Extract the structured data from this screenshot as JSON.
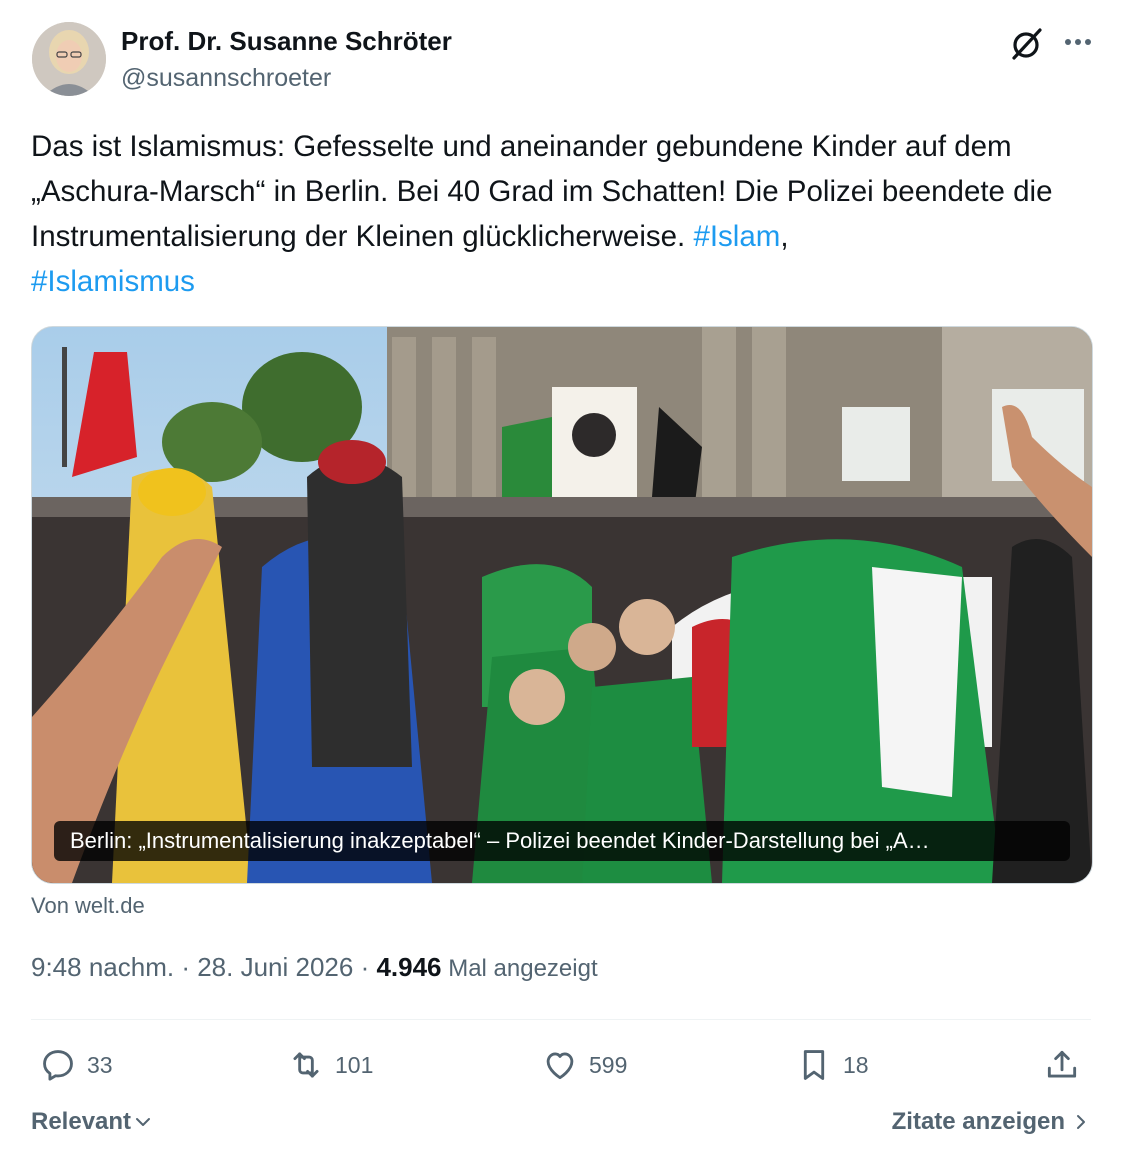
{
  "author": {
    "name": "Prof. Dr. Susanne Schröter",
    "handle": "@susannschroeter",
    "avatar_icon": "avatar-photo"
  },
  "header_icons": [
    "grok-icon",
    "more-options-icon"
  ],
  "tweet": {
    "text_main": "Das ist Islamismus: Gefesselte und aneinander gebundene Kinder auf dem „Aschura-Marsch“ in Berlin. Bei 40 Grad im Schatten! Die Polizei beendete die Instrumentalisierung der Kleinen glücklicherweise. ",
    "hashtag_1": "#Islam",
    "separator": ",",
    "hashtag_2": "#Islamismus"
  },
  "link_card": {
    "caption": "Berlin: „Instrumentalisierung inakzeptabel“ – Polizei beendet Kinder-Darstellung bei „A…",
    "source": "Von welt.de"
  },
  "meta": {
    "time": "9:48 nachm.",
    "sep1": " · ",
    "date": "28. Juni 2026",
    "sep2": " · ",
    "views_count": "4.946",
    "views_label": " Mal angezeigt"
  },
  "actions": {
    "replies": "33",
    "retweets": "101",
    "likes": "599",
    "bookmarks": "18"
  },
  "footer": {
    "sort_label": "Relevant",
    "quotes_label": "Zitate anzeigen"
  },
  "colors": {
    "text": "#0f1419",
    "secondary": "#536471",
    "accent": "#1d9bf0",
    "border": "#cfd9de"
  }
}
